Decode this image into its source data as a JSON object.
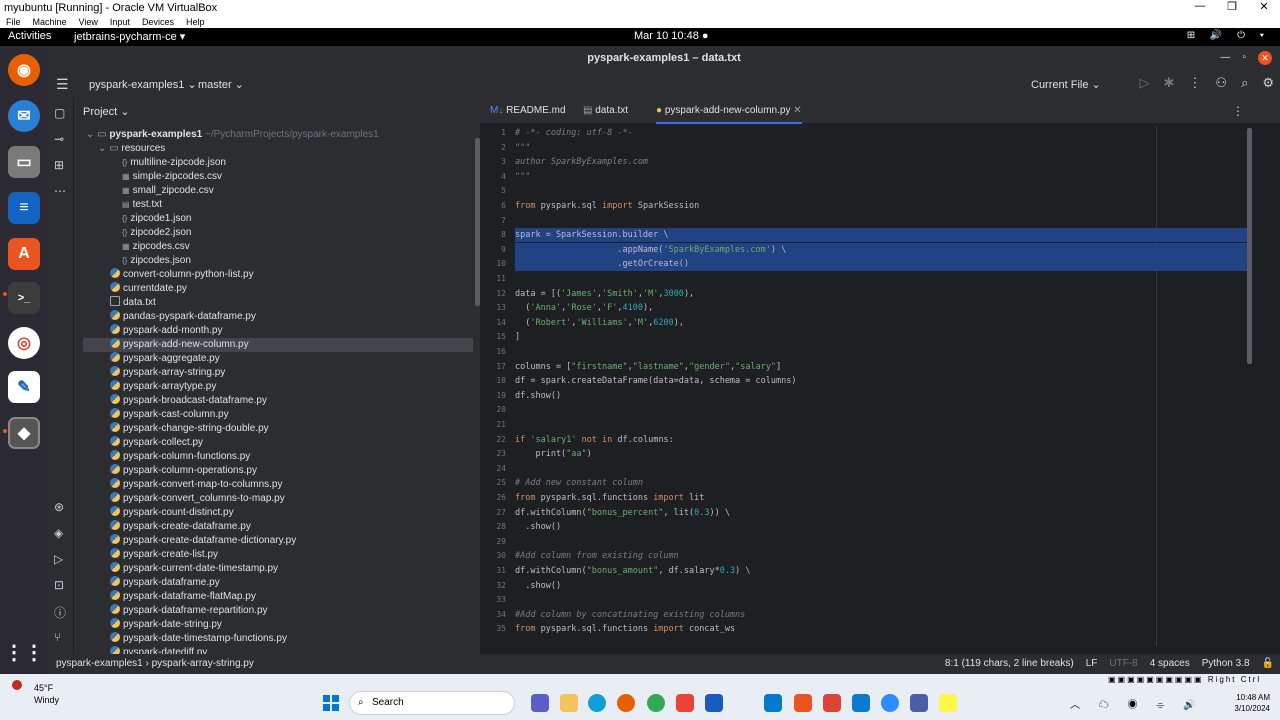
{
  "vbox": {
    "title": "myubuntu [Running] - Oracle VM VirtualBox",
    "menu": [
      "File",
      "Machine",
      "View",
      "Input",
      "Devices",
      "Help"
    ],
    "controls": [
      "—",
      "❐",
      "✕"
    ]
  },
  "gnome": {
    "activities": "Activities",
    "app": "jetbrains-pycharm-ce ▾",
    "clock": "Mar 10  10:48  ●",
    "tray": "⊞ 🔊 ⏻ ▾"
  },
  "ide": {
    "title": "pyspark-examples1 – data.txt",
    "project_selector": "pyspark-examples1 ⌄",
    "branch": "master ⌄",
    "run_config": "Current File ⌄",
    "project_header": "Project ⌄",
    "root": "pyspark-examples1",
    "root_path": "~/PycharmProjects/pyspark-examples1",
    "folder": "resources",
    "resources": [
      "multiline-zipcode.json",
      "simple-zipcodes.csv",
      "small_zipcode.csv",
      "test.txt",
      "zipcode1.json",
      "zipcode2.json",
      "zipcodes.csv",
      "zipcodes.json"
    ],
    "files": [
      "convert-column-python-list.py",
      "currentdate.py",
      "data.txt",
      "pandas-pyspark-dataframe.py",
      "pyspark-add-month.py",
      "pyspark-add-new-column.py",
      "pyspark-aggregate.py",
      "pyspark-array-string.py",
      "pyspark-arraytype.py",
      "pyspark-broadcast-dataframe.py",
      "pyspark-cast-column.py",
      "pyspark-change-string-double.py",
      "pyspark-collect.py",
      "pyspark-column-functions.py",
      "pyspark-column-operations.py",
      "pyspark-convert-map-to-columns.py",
      "pyspark-convert_columns-to-map.py",
      "pyspark-count-distinct.py",
      "pyspark-create-dataframe.py",
      "pyspark-create-dataframe-dictionary.py",
      "pyspark-create-list.py",
      "pyspark-current-date-timestamp.py",
      "pyspark-dataframe.py",
      "pyspark-dataframe-flatMap.py",
      "pyspark-dataframe-repartition.py",
      "pyspark-date-string.py",
      "pyspark-date-timestamp-functions.py",
      "pyspark-datediff.py"
    ],
    "tabs": [
      "README.md",
      "data.txt",
      "pyspark-add-new-column.py"
    ],
    "line_numbers": [
      "1",
      "2",
      "3",
      "4",
      "5",
      "6",
      "7",
      "8",
      "9",
      "10",
      "11",
      "12",
      "13",
      "14",
      "15",
      "16",
      "17",
      "18",
      "19",
      "20",
      "21",
      "22",
      "23",
      "24",
      "25",
      "26",
      "27",
      "28",
      "29",
      "30",
      "31",
      "32",
      "33",
      "34",
      "35"
    ],
    "statusbar": {
      "breadcrumb": "pyspark-examples1  ›  pyspark-array-string.py",
      "position": "8:1 (119 chars, 2 line breaks)",
      "line_sep": "LF",
      "encoding": "UTF-8",
      "indent": "4 spaces",
      "interpreter": "Python 3.8"
    }
  },
  "code_lines": [
    "# -*- coding: utf-8 -*-",
    "\"\"\"",
    "author SparkByExamples.com",
    "\"\"\"",
    "",
    "from pyspark.sql import SparkSession",
    "",
    "spark = SparkSession.builder \\",
    "                    .appName('SparkByExamples.com') \\",
    "                    .getOrCreate()",
    "",
    "data = [('James','Smith','M',3000),",
    "  ('Anna','Rose','F',4100),",
    "  ('Robert','Williams','M',6200),",
    "]",
    "",
    "columns = [\"firstname\",\"lastname\",\"gender\",\"salary\"]",
    "df = spark.createDataFrame(data=data, schema = columns)",
    "df.show()",
    "",
    "",
    "if 'salary1' not in df.columns:",
    "    print(\"aa\")",
    "",
    "# Add new constant column",
    "from pyspark.sql.functions import lit",
    "df.withColumn(\"bonus_percent\", lit(0.3)) \\",
    "  .show()",
    "",
    "#Add column from existing column",
    "df.withColumn(\"bonus_amount\", df.salary*0.3) \\",
    "  .show()",
    "",
    "#Add column by concatinating existing columns",
    "from pyspark.sql.functions import concat_ws"
  ],
  "taskbar": {
    "temp": "45°F",
    "weather": "Windy",
    "search": "Search",
    "time": "10:48 AM",
    "date": "3/10/2024",
    "vbox_key": "Right Ctrl"
  }
}
